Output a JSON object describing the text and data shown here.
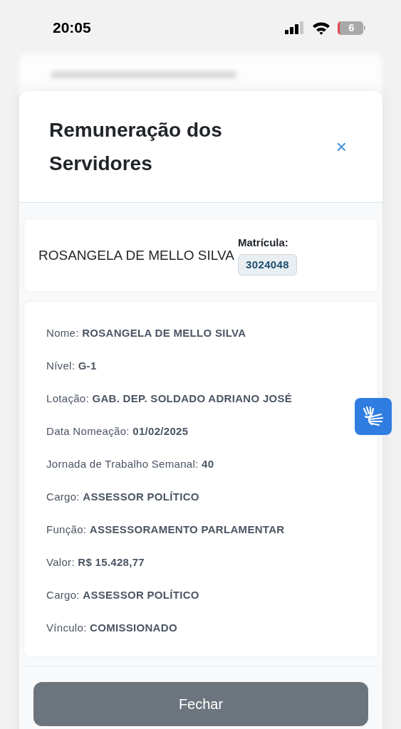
{
  "status_bar": {
    "time": "20:05",
    "battery": "6"
  },
  "modal": {
    "title": "Remuneração dos Servidores",
    "close": "×",
    "summary": {
      "name": "ROSANGELA DE MELLO SILVA",
      "matricula_label": "Matrícula:",
      "matricula": "3024048"
    },
    "details": [
      {
        "label": "Nome:",
        "value": "ROSANGELA DE MELLO SILVA"
      },
      {
        "label": "Nível:",
        "value": "G-1"
      },
      {
        "label": "Lotação:",
        "value": "GAB. DEP. SOLDADO ADRIANO JOSÉ"
      },
      {
        "label": "Data Nomeação:",
        "value": "01/02/2025"
      },
      {
        "label": "Jornada de Trabalho Semanal:",
        "value": "40"
      },
      {
        "label": "Cargo:",
        "value": "ASSESSOR POLÍTICO"
      },
      {
        "label": "Função:",
        "value": "ASSESSORAMENTO PARLAMENTAR"
      },
      {
        "label": "Valor:",
        "value": "R$ 15.428,77"
      },
      {
        "label": "Cargo:",
        "value": "ASSESSOR POLÍTICO"
      },
      {
        "label": "Vínculo:",
        "value": "COMISSIONADO"
      }
    ],
    "button": "Fechar"
  }
}
